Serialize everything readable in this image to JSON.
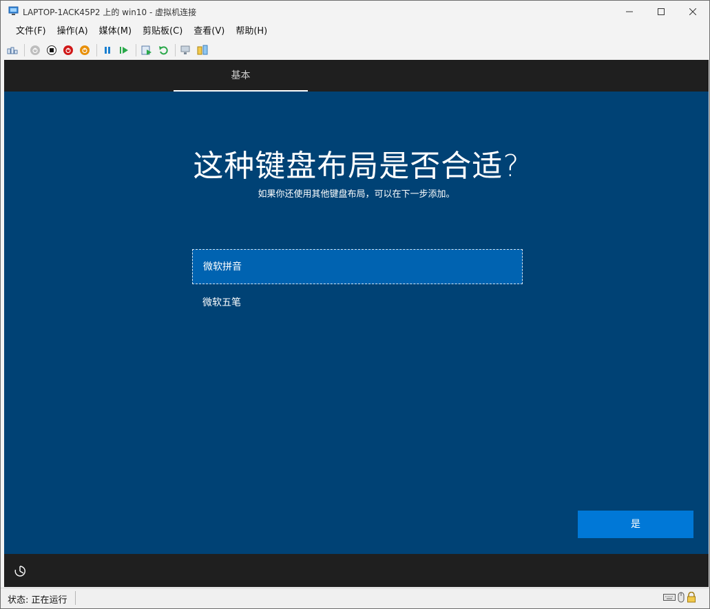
{
  "window": {
    "title": "LAPTOP-1ACK45P2 上的 win10 - 虚拟机连接"
  },
  "menu": [
    "文件(F)",
    "操作(A)",
    "媒体(M)",
    "剪贴板(C)",
    "查看(V)",
    "帮助(H)"
  ],
  "toolbar": {
    "icons": [
      "ctrl-alt-del-icon",
      "start-icon",
      "turn-off-icon",
      "shutdown-icon",
      "save-icon",
      "pause-icon",
      "resume-icon",
      "checkpoint-icon",
      "revert-icon",
      "enhanced-session-icon",
      "share-icon"
    ]
  },
  "oobe": {
    "tab_label": "基本",
    "heading": "这种键盘布局是否合适?",
    "subheading": "如果你还使用其他键盘布局，可以在下一步添加。",
    "options": [
      "微软拼音",
      "微软五笔"
    ],
    "selected_option": "微软拼音",
    "yes_button": "是"
  },
  "status": {
    "text": "状态: 正在运行"
  },
  "colors": {
    "vm_background": "#004275",
    "selected_option": "#0063b1",
    "primary_button": "#0078d7",
    "dark_bar": "#1f1f1f"
  }
}
